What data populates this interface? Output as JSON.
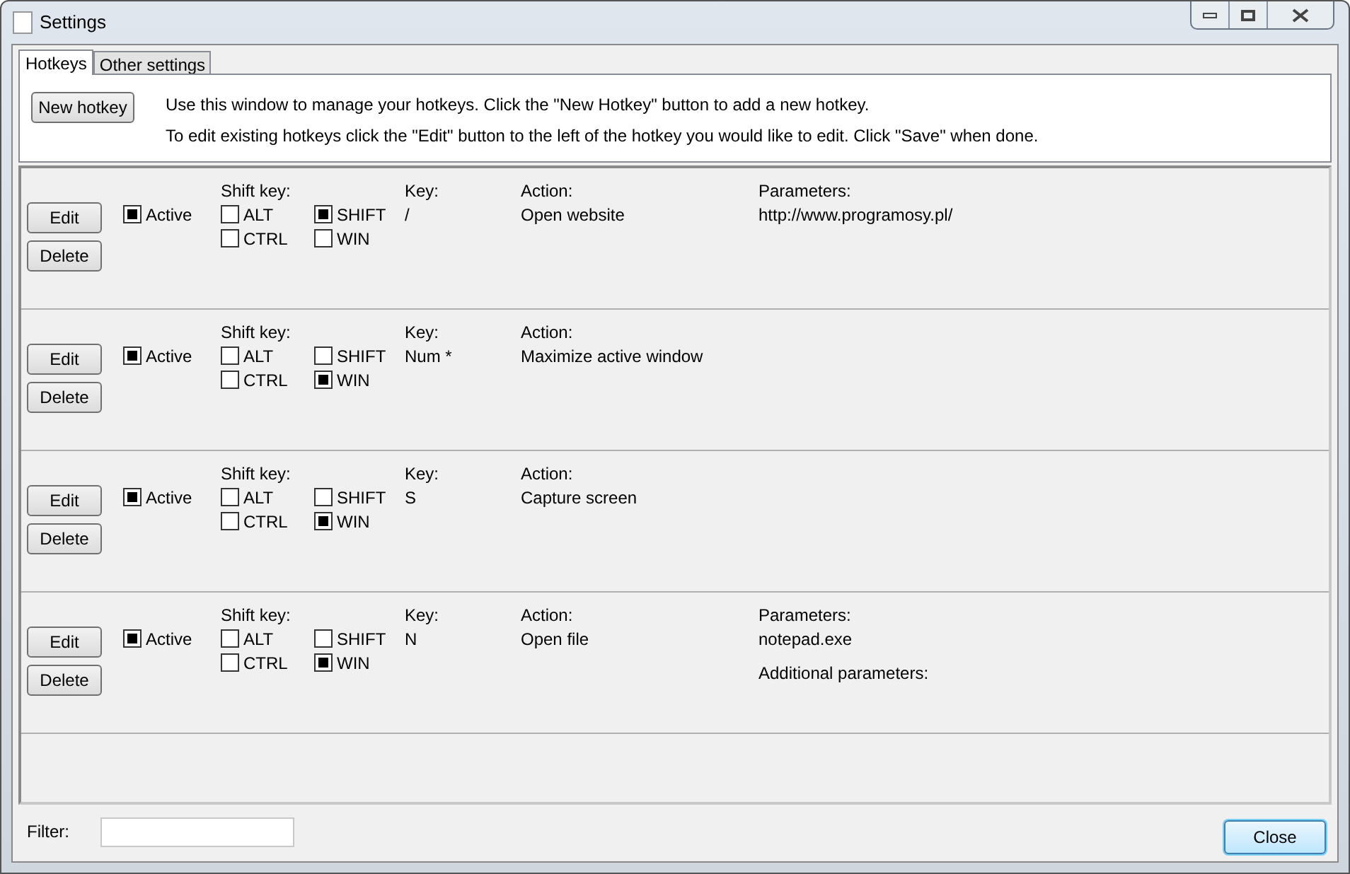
{
  "window": {
    "title": "Settings"
  },
  "tabs": [
    {
      "label": "Hotkeys",
      "selected": true
    },
    {
      "label": "Other settings",
      "selected": false
    }
  ],
  "new_hotkey_button": "New hotkey",
  "instructions": [
    "Use this window to manage your hotkeys. Click the \"New Hotkey\" button to add a new hotkey.",
    "To edit existing hotkeys click the \"Edit\" button to the left of the hotkey you would like to edit. Click \"Save\" when done."
  ],
  "hotkeys": [
    {
      "edit": "Edit",
      "delete": "Delete",
      "active": {
        "label": "Active",
        "checked": true
      },
      "shift_key_heading": "Shift key:",
      "modifiers": [
        {
          "label": "ALT",
          "checked": false
        },
        {
          "label": "SHIFT",
          "checked": true
        },
        {
          "label": "CTRL",
          "checked": false
        },
        {
          "label": "WIN",
          "checked": false
        }
      ],
      "key_heading": "Key:",
      "key": "/",
      "action_heading": "Action:",
      "action": "Open website",
      "parameters_heading": "Parameters:",
      "parameters": "http://www.programosy.pl/"
    },
    {
      "edit": "Edit",
      "delete": "Delete",
      "active": {
        "label": "Active",
        "checked": true
      },
      "shift_key_heading": "Shift key:",
      "modifiers": [
        {
          "label": "ALT",
          "checked": false
        },
        {
          "label": "SHIFT",
          "checked": false
        },
        {
          "label": "CTRL",
          "checked": false
        },
        {
          "label": "WIN",
          "checked": true
        }
      ],
      "key_heading": "Key:",
      "key": "Num *",
      "action_heading": "Action:",
      "action": "Maximize active window"
    },
    {
      "edit": "Edit",
      "delete": "Delete",
      "active": {
        "label": "Active",
        "checked": true
      },
      "shift_key_heading": "Shift key:",
      "modifiers": [
        {
          "label": "ALT",
          "checked": false
        },
        {
          "label": "SHIFT",
          "checked": false
        },
        {
          "label": "CTRL",
          "checked": false
        },
        {
          "label": "WIN",
          "checked": true
        }
      ],
      "key_heading": "Key:",
      "key": "S",
      "action_heading": "Action:",
      "action": "Capture screen"
    },
    {
      "edit": "Edit",
      "delete": "Delete",
      "active": {
        "label": "Active",
        "checked": true
      },
      "shift_key_heading": "Shift key:",
      "modifiers": [
        {
          "label": "ALT",
          "checked": false
        },
        {
          "label": "SHIFT",
          "checked": false
        },
        {
          "label": "CTRL",
          "checked": false
        },
        {
          "label": "WIN",
          "checked": true
        }
      ],
      "key_heading": "Key:",
      "key": "N",
      "action_heading": "Action:",
      "action": "Open file",
      "parameters_heading": "Parameters:",
      "parameters": "notepad.exe",
      "additional_parameters_heading": "Additional parameters:"
    }
  ],
  "filter": {
    "label": "Filter:"
  },
  "close_button": "Close"
}
